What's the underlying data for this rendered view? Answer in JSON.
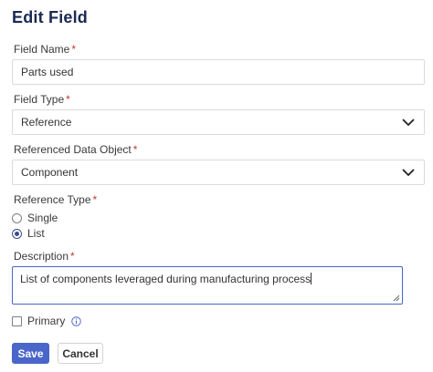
{
  "dialog": {
    "title": "Edit Field"
  },
  "required_marker": "*",
  "field_name": {
    "label": "Field Name",
    "value": "Parts used"
  },
  "field_type": {
    "label": "Field Type",
    "value": "Reference"
  },
  "referenced_object": {
    "label": "Referenced Data Object",
    "value": "Component"
  },
  "reference_type": {
    "label": "Reference Type",
    "options": [
      {
        "label": "Single",
        "checked": false
      },
      {
        "label": "List",
        "checked": true
      }
    ]
  },
  "description": {
    "label": "Description",
    "value": "List of components leveraged during manufacturing process"
  },
  "primary": {
    "label": "Primary",
    "checked": false
  },
  "buttons": {
    "save": "Save",
    "cancel": "Cancel"
  },
  "colors": {
    "title": "#1b2a52",
    "accent": "#4a66c8",
    "required": "#c0392b"
  },
  "icons": {
    "dropdown": "chevron-down-icon",
    "info": "info-icon",
    "resize": "resize-handle-icon"
  }
}
